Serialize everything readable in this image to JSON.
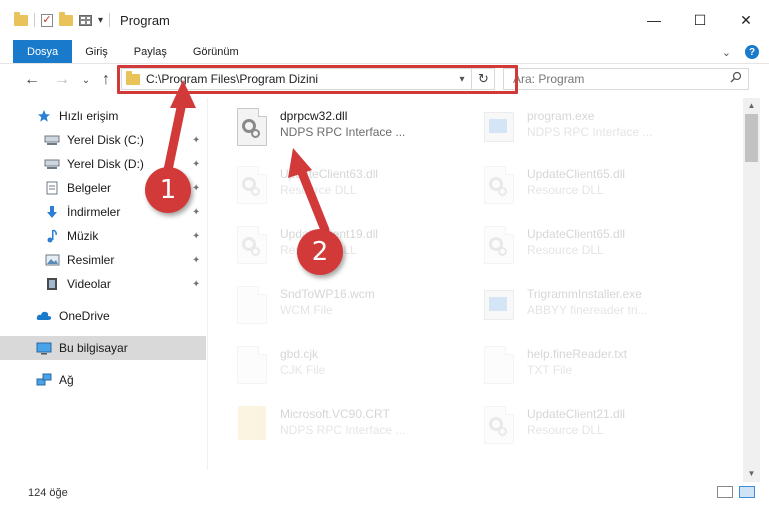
{
  "window": {
    "title": "Program",
    "minimize": "—",
    "maximize": "☐",
    "close": "✕"
  },
  "ribbon": {
    "tabs": [
      "Dosya",
      "Giriş",
      "Paylaş",
      "Görünüm"
    ],
    "expand": "⌄",
    "help": "?"
  },
  "nav": {
    "back": "←",
    "forward": "→",
    "recent": "⌄",
    "up": "↑"
  },
  "address": {
    "path": "C:\\Program Files\\Program Dizini",
    "refresh": "↻"
  },
  "search": {
    "placeholder": "Ara: Program"
  },
  "sidebar": {
    "items": [
      {
        "label": "Hızlı erişim",
        "icon": "star-icon"
      },
      {
        "label": "Yerel Disk (C:)",
        "icon": "drive-icon"
      },
      {
        "label": "Yerel Disk (D:)",
        "icon": "drive-icon"
      },
      {
        "label": "Belgeler",
        "icon": "documents-icon"
      },
      {
        "label": "İndirmeler",
        "icon": "download-icon"
      },
      {
        "label": "Müzik",
        "icon": "music-icon"
      },
      {
        "label": "Resimler",
        "icon": "pictures-icon"
      },
      {
        "label": "Videolar",
        "icon": "video-icon"
      },
      {
        "label": "OneDrive",
        "icon": "cloud-icon"
      },
      {
        "label": "Bu bilgisayar",
        "icon": "computer-icon"
      },
      {
        "label": "Ağ",
        "icon": "network-icon"
      }
    ],
    "pin": "📌"
  },
  "files": {
    "items": [
      {
        "name": "dprpcw32.dll",
        "type": "NDPS RPC Interface ..."
      },
      {
        "name": "program.exe",
        "type": "NDPS RPC Interface ..."
      },
      {
        "name": "UpdateClient63.dll",
        "type": "Resource DLL"
      },
      {
        "name": "UpdateClient65.dll",
        "type": "Resource DLL"
      },
      {
        "name": "UpdateClient19.dll",
        "type": "Resource DLL"
      },
      {
        "name": "UpdateClient65.dll",
        "type": "Resource DLL"
      },
      {
        "name": "SndToWP16.wcm",
        "type": "WCM File"
      },
      {
        "name": "TrigrammInstaller.exe",
        "type": "ABBYY finereader tri..."
      },
      {
        "name": "gbd.cjk",
        "type": "CJK File"
      },
      {
        "name": "help.fineReader.txt",
        "type": "TXT File"
      },
      {
        "name": "Microsoft.VC90.CRT",
        "type": "NDPS RPC Interface ..."
      },
      {
        "name": "UpdateClient21.dll",
        "type": "Resource DLL"
      }
    ]
  },
  "status": {
    "count": "124 öğe"
  },
  "annotations": {
    "marker1": "1",
    "marker2": "2",
    "color": "#d23a3a"
  }
}
